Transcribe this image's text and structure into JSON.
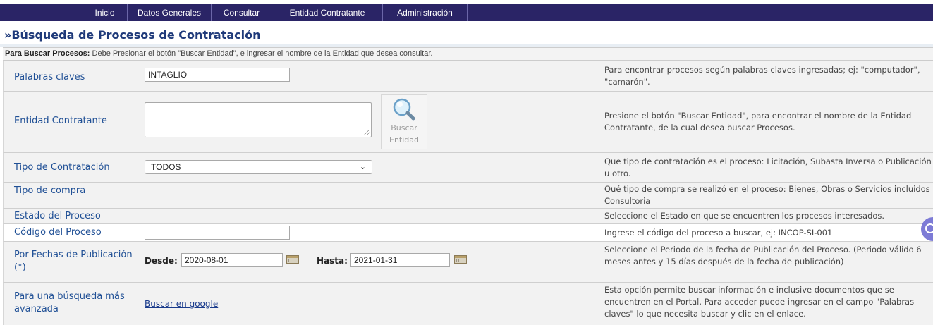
{
  "nav": {
    "items": [
      "Inicio",
      "Datos Generales",
      "Consultar",
      "Entidad Contratante",
      "Administración"
    ]
  },
  "page": {
    "title": "»Búsqueda de Procesos de Contratación",
    "hint_bold": "Para Buscar Procesos:",
    "hint_text": " Debe Presionar el botón \"Buscar Entidad\", e ingresar el nombre de la Entidad que desea consultar."
  },
  "form": {
    "keywords": {
      "label": "Palabras claves",
      "value": "INTAGLIO",
      "help": "Para encontrar procesos según palabras claves ingresadas; ej: \"computador\", \"camarón\"."
    },
    "entity": {
      "label": "Entidad Contratante",
      "value": "",
      "button_label_1": "Buscar",
      "button_label_2": "Entidad",
      "help": "Presione el botón \"Buscar Entidad\", para encontrar el nombre de la Entidad Contratante, de la cual desea buscar Procesos."
    },
    "contract_type": {
      "label": "Tipo de Contratación",
      "selected": "TODOS",
      "help": "Que tipo de contratación es el proceso: Licitación, Subasta Inversa o Publicación u otro."
    },
    "purchase_type": {
      "label": "Tipo de compra",
      "help": "Qué tipo de compra se realizó en el proceso: Bienes, Obras o Servicios incluidos Consultoria"
    },
    "status": {
      "label": "Estado del Proceso",
      "help": "Seleccione el Estado en que se encuentren los procesos interesados."
    },
    "code": {
      "label": "Código del Proceso",
      "value": "",
      "help": "Ingrese el código del proceso a buscar, ej: INCOP-SI-001"
    },
    "dates": {
      "label_1": "Por Fechas de Publicación",
      "label_2": "(*)",
      "from_label": "Desde:",
      "from_value": "2020-08-01",
      "to_label": "Hasta:",
      "to_value": "2021-01-31",
      "help": "Seleccione el Periodo de la fecha de Publicación del Proceso. (Periodo válido 6 meses antes y 15 días después de la fecha de publicación)"
    },
    "advanced": {
      "label_1": "Para una búsqueda más",
      "label_2": "avanzada",
      "link": "Buscar en google",
      "help": "Esta opción permite buscar información e inclusive documentos que se encuentren en el Portal. Para acceder puede ingresar en el campo \"Palabras claves\" lo que necesita buscar y clic en el enlace."
    }
  },
  "colors": {
    "nav_bg": "#2a2466",
    "label": "#1f4f95",
    "row_bg": "#f2f2f2"
  }
}
